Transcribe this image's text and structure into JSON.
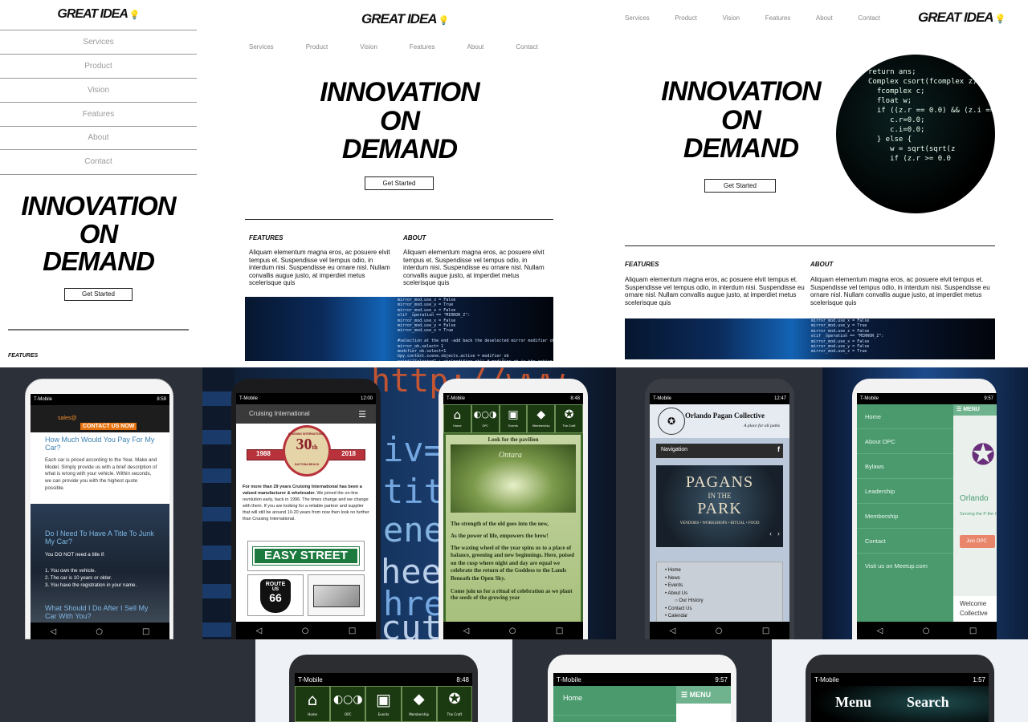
{
  "brand": {
    "logo_text": "GREAT IDEA",
    "bulb_glyph": "💡"
  },
  "nav": [
    "Services",
    "Product",
    "Vision",
    "Features",
    "About",
    "Contact"
  ],
  "hero": {
    "line1": "INNOVATION",
    "line2": "ON",
    "line3": "DEMAND",
    "cta": "Get Started"
  },
  "sections": {
    "features_title": "FEATURES",
    "about_title": "ABOUT",
    "body": "Aliquam elementum magna eros, ac posuere elvit tempus et. Suspendisse vel tempus odio, in interdum nisi. Suspendisse eu ornare nisl. Nullam convallis augue justo, at imperdiet metus scelerisque quis"
  },
  "code_text": {
    "strip1": "mirror_mod.use_x = False\nmirror_mod.use_y = True\nmirror_mod.use_z = False\nelif _operation == \"MIRROR_Z\":\nmirror_mod.use_x = False\nmirror_mod.use_y = False\nmirror_mod.use_z = True\n\n#selection at the end -add back the deselected mirror modifier object\nmirror_ob.select= 1\nmodifier_ob.select=1\nbpy.context.scene.objects.active = modifier_ob\nprint(\"Selected\" + str(modifier_ob)) # modifier ob is the active ob\n  mirror_ob.select = 0",
    "circle": "return ans;\nComplex csort(fcomplex z)\n  fcomplex c;\n  float w;\n  if ((z.r == 0.0) && (z.i == 0.0))\n     c.r=0.0;\n     c.i=0.0;\n  } else {\n     w = sqrt(sqrt(z\n     if (z.r >= 0.0"
  },
  "phones": {
    "p1": {
      "carrier": "T-Mobile",
      "time": "8:59",
      "email": "sales@",
      "cta": "CONTACT US NOW",
      "h1": "How Much Would You Pay For My Car?",
      "p1": "Each car is priced according to the Year, Make and Model. Simply provide us with a brief description of what is wrong with your vehicle. Within seconds, we can provide you with the highest quote possible.",
      "h2": "Do I Need To Have A Title To Junk My Car?",
      "p2": "You DO NOT need a title if:",
      "list": [
        "1. You own the vehicle.",
        "2. The car is 10 years or older.",
        "3. You have the registration in your name."
      ],
      "h3": "What Should I Do After I Sell My Car With You?"
    },
    "p2": {
      "carrier": "T-Mobile",
      "time": "12:00",
      "title": "Cruising International",
      "badge_top": "CRUISING INTERNATIONAL",
      "badge_num": "30",
      "badge_suffix": "th",
      "year_left": "1988",
      "year_right": "2018",
      "badge_bottom": "DAYTONA BEACH",
      "text_bold": "For more than 29 years Cruising International has been a valued manufacturer & wholesaler.",
      "text": "We joined the on-line revolution early, back in 1996. The times change and we change with them. If you are looking for a reliable partner and supplier that will still be around 10-20 years from now then look no further than Cruising International.",
      "sign": "EASY STREET",
      "route_a": "ROUTE",
      "route_b": "US",
      "route_c": "66"
    },
    "p3": {
      "carrier": "T-Mobile",
      "time": "8:48",
      "nav": [
        "Home",
        "OPC",
        "Events",
        "Membership",
        "The Craft"
      ],
      "pavilion": "Look for the pavilion",
      "ontara": "Ontara",
      "t1": "The strength of the old goes into the new,",
      "t2": "As the power of life, empowers the brew!",
      "t3": "The waxing wheel of the year spins us to a place of balance, greening and new beginnings. Here, poised on the cusp where night and day are equal we celebrate the return of the Goddess to the Lands Beneath the Open Sky.",
      "t4": "Come join us for a ritual of celebration as we plant the seeds of the growing year"
    },
    "p4": {
      "carrier": "T-Mobile",
      "time": "12:47",
      "title": "Orlando Pagan Collective",
      "subtitle": "A place for all paths",
      "navigation": "Navigation",
      "fb": "f",
      "poster_a": "PAGANS",
      "poster_b": "IN THE",
      "poster_c": "PARK",
      "poster_d": "VENDORS • WORKSHOPS • RITUAL • FOOD",
      "menu": [
        "Home",
        "News",
        "Events",
        "About Us",
        "Our History",
        "Contact Us",
        "Calendar"
      ]
    },
    "p5": {
      "carrier": "T-Mobile",
      "time": "9:57",
      "menu_label": "MENU",
      "items": [
        "Home",
        "About OPC",
        "Bylaws",
        "Leadership",
        "Membership",
        "Contact",
        "Visit us on Meetup.com"
      ],
      "orlando": "Orlando",
      "serving": "Serving the P the Central F",
      "join": "Join OPC",
      "welcome": "Welcome Collective"
    },
    "p6": {
      "carrier": "T-Mobile",
      "time": "8:48",
      "nav": [
        "Home",
        "OPC",
        "Events",
        "Membership",
        "The Craft"
      ]
    },
    "p7": {
      "carrier": "T-Mobile",
      "time": "9:57",
      "menu_label": "MENU",
      "item": "Home"
    },
    "p8": {
      "carrier": "T-Mobile",
      "time": "1:57",
      "menu": "Menu",
      "search": "Search"
    }
  },
  "bg_code": {
    "c1": "http://www",
    "c2": "iv=\"C",
    "c3": "title",
    "c4": "enera",
    "c5": "heet\"",
    "c6": "href=",
    "c7": "cut ic"
  },
  "colors": {
    "green": "#4a9a6e",
    "orange": "#e8730e",
    "dark": "#2c3038",
    "blue": "#1363b5"
  }
}
